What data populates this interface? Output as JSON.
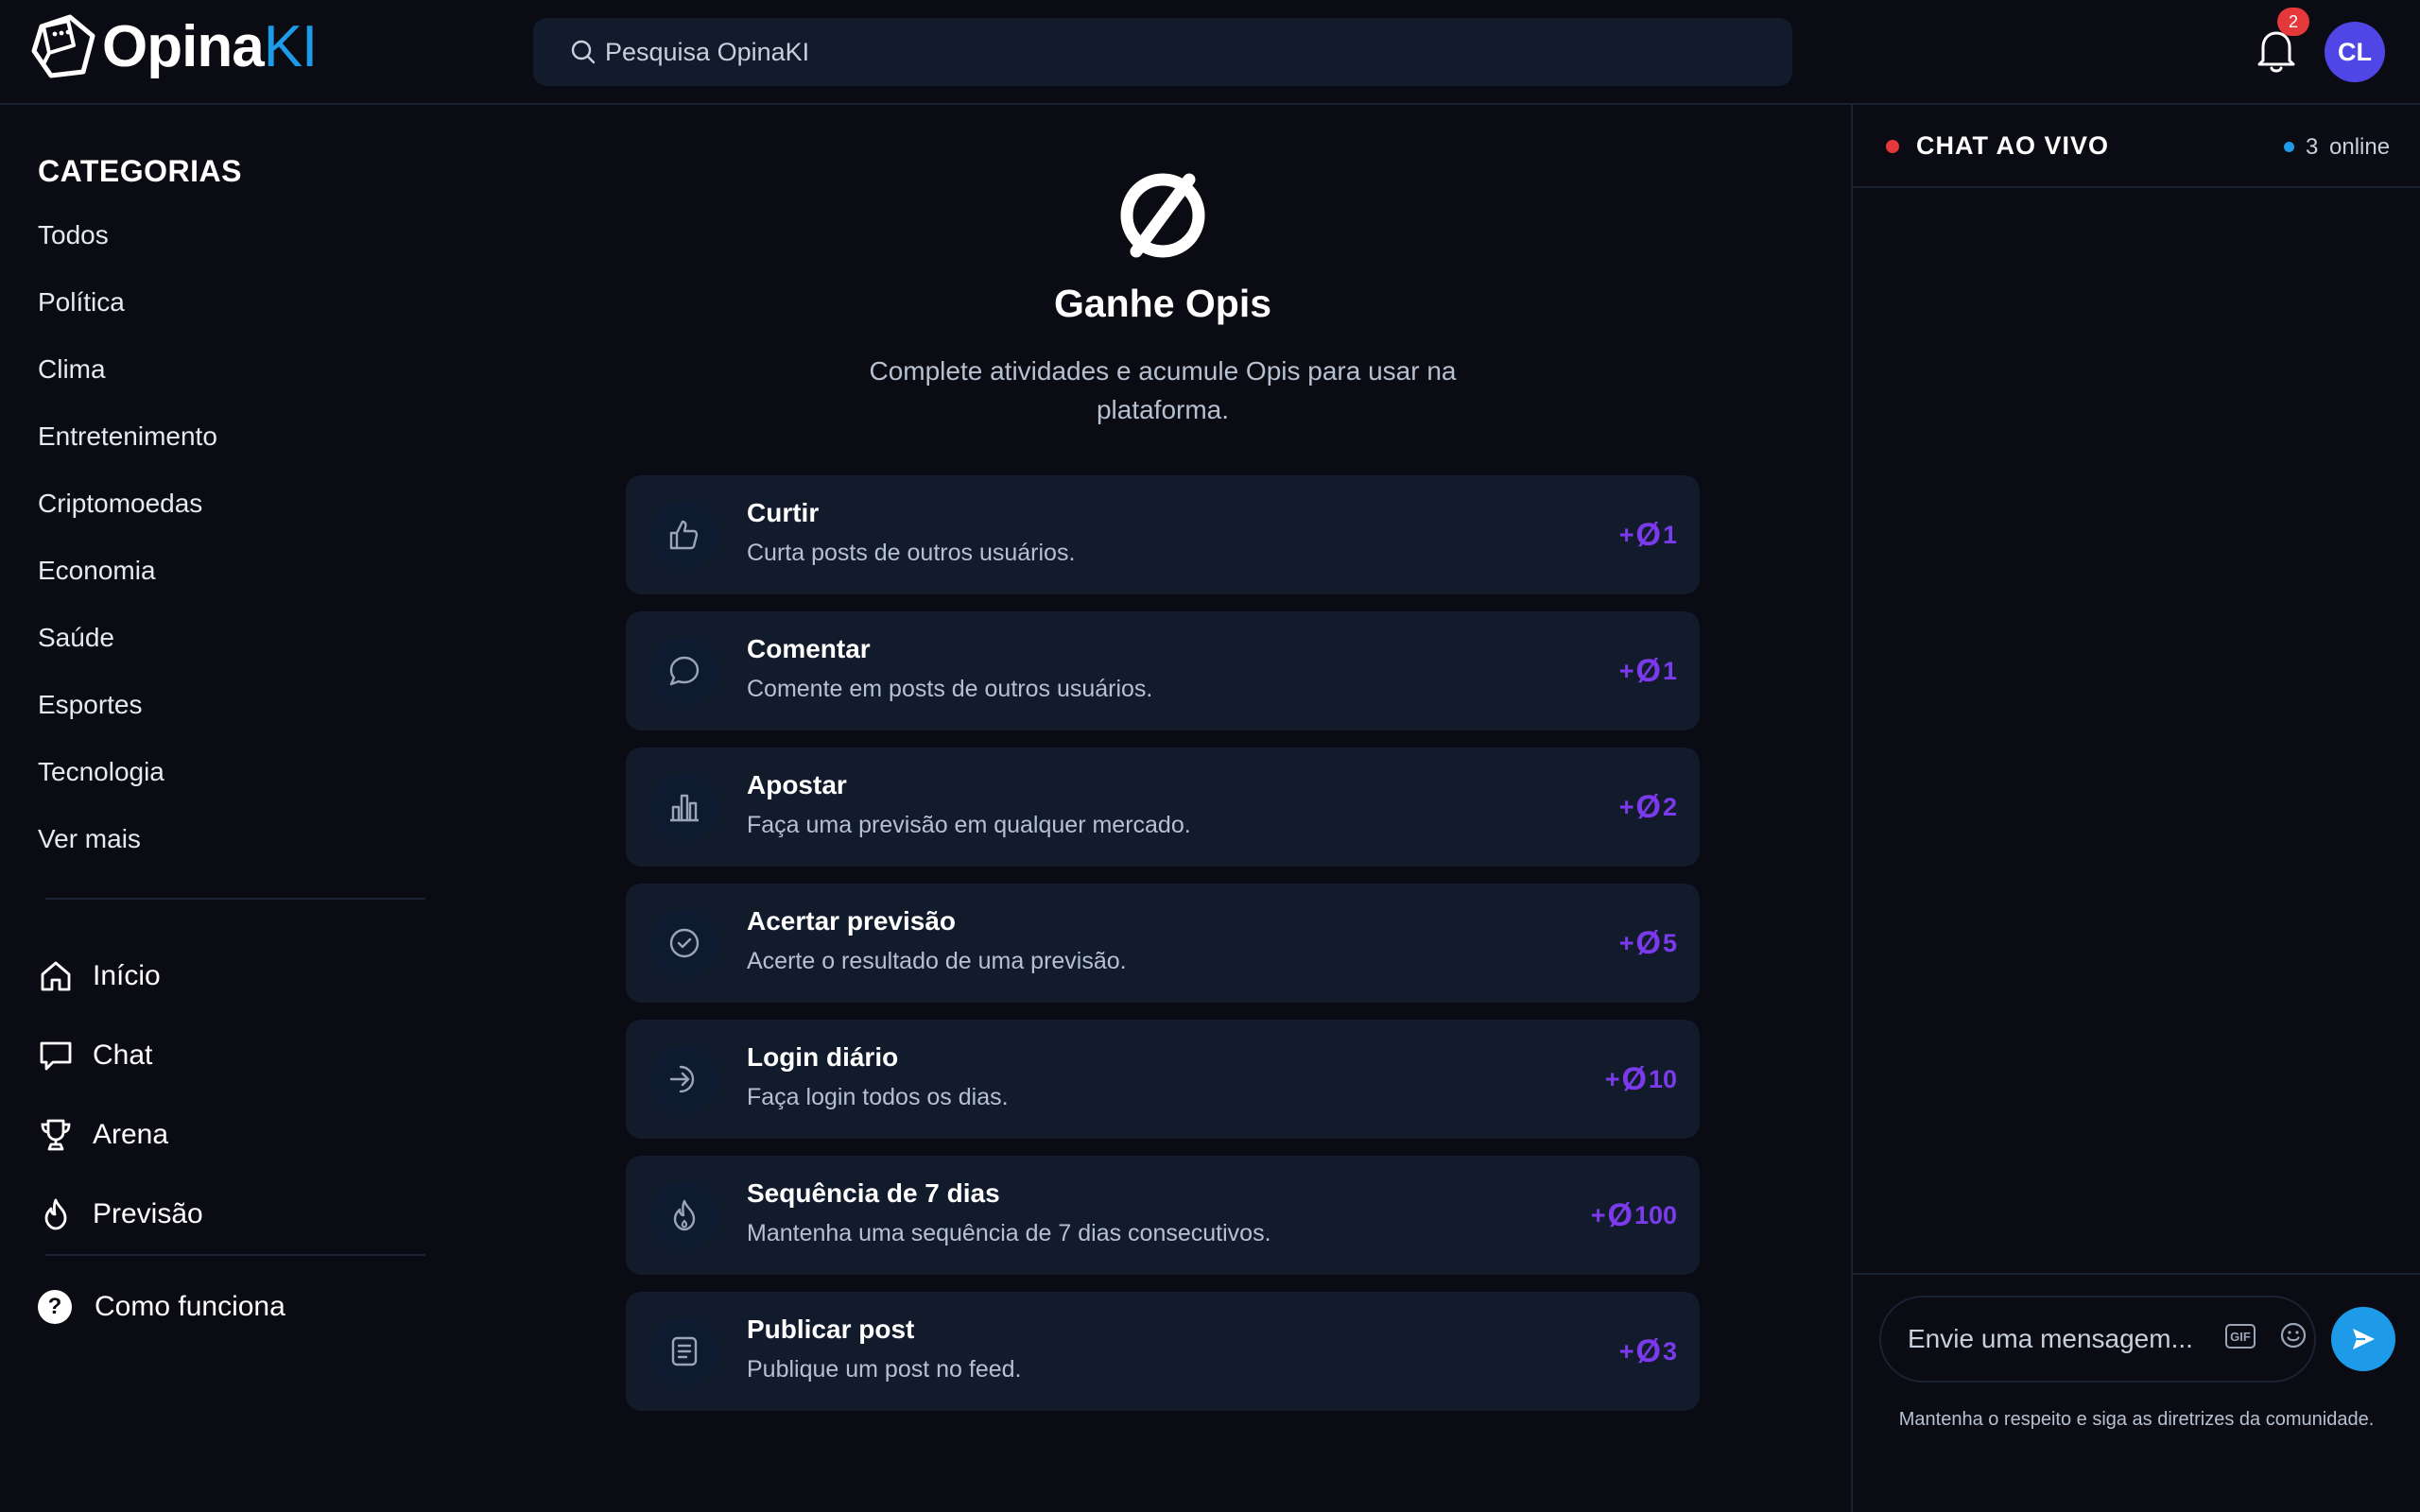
{
  "header": {
    "logo_main": "Opina",
    "logo_accent": "KI",
    "search_placeholder": "Pesquisa OpinaKI",
    "notification_count": "2",
    "avatar_initials": "CL"
  },
  "sidebar": {
    "categories_title": "CATEGORIAS",
    "categories": [
      "Todos",
      "Política",
      "Clima",
      "Entretenimento",
      "Criptomoedas",
      "Economia",
      "Saúde",
      "Esportes",
      "Tecnologia",
      "Ver mais"
    ],
    "nav": [
      {
        "label": "Início",
        "icon": "home-icon"
      },
      {
        "label": "Chat",
        "icon": "chat-icon"
      },
      {
        "label": "Arena",
        "icon": "trophy-icon"
      },
      {
        "label": "Previsão",
        "icon": "flame-icon"
      }
    ],
    "how_it_works": "Como funciona"
  },
  "main": {
    "title": "Ganhe Opis",
    "subtitle": "Complete atividades e acumule Opis para usar na plataforma.",
    "currency_symbol": "Ø",
    "tasks": [
      {
        "title": "Curtir",
        "desc": "Curta posts de outros usuários.",
        "reward": "1",
        "icon": "thumbs-up-icon"
      },
      {
        "title": "Comentar",
        "desc": "Comente em posts de outros usuários.",
        "reward": "1",
        "icon": "comment-icon"
      },
      {
        "title": "Apostar",
        "desc": "Faça uma previsão em qualquer mercado.",
        "reward": "2",
        "icon": "bar-chart-icon"
      },
      {
        "title": "Acertar previsão",
        "desc": "Acerte o resultado de uma previsão.",
        "reward": "5",
        "icon": "check-circle-icon"
      },
      {
        "title": "Login diário",
        "desc": "Faça login todos os dias.",
        "reward": "10",
        "icon": "login-arrow-icon"
      },
      {
        "title": "Sequência de 7 dias",
        "desc": "Mantenha uma sequência de 7 dias consecutivos.",
        "reward": "100",
        "icon": "flame-icon"
      },
      {
        "title": "Publicar post",
        "desc": "Publique um post no feed.",
        "reward": "3",
        "icon": "document-icon"
      }
    ]
  },
  "chat": {
    "title": "CHAT AO VIVO",
    "online_count": "3",
    "online_label": "online",
    "input_placeholder": "Envie uma mensagem...",
    "gif_label": "GIF",
    "guidelines": "Mantenha o respeito e siga as diretrizes da comunidade."
  },
  "colors": {
    "background": "#0b0b14",
    "card": "#111b2c",
    "accent_blue": "#1e9be8",
    "reward_purple": "#7c3aed",
    "live_red": "#e5383b",
    "avatar": "#4f46e5"
  }
}
